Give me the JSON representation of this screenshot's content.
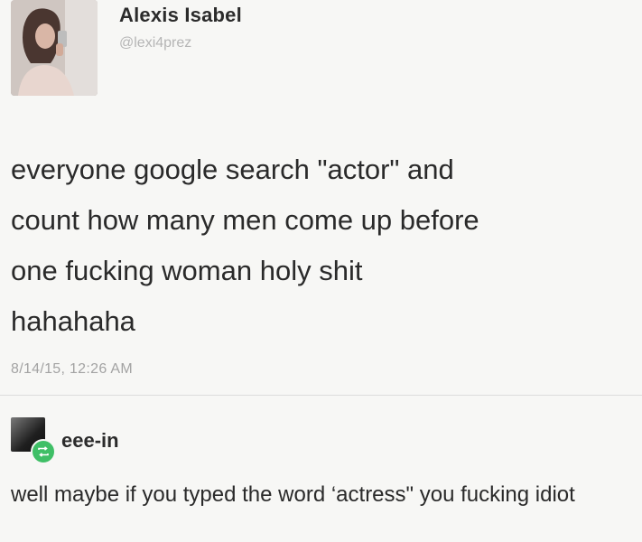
{
  "tweet": {
    "author_name": "Alexis Isabel",
    "author_handle": "@lexi4prez",
    "text": "everyone google search \"actor\" and\ncount how many men come up before\none fucking woman holy shit\nhahahaha",
    "timestamp": "8/14/15, 12:26 AM",
    "avatar_icon": "profile-photo"
  },
  "reply": {
    "author_name": "eee-in",
    "text": "well maybe if you typed the word ‘actress\" you fucking idiot",
    "badge_icon": "retweet-icon",
    "badge_color": "#3fbf66"
  }
}
